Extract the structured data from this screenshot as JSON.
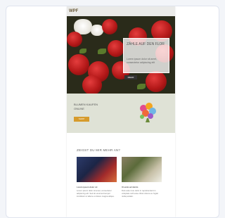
{
  "site": {
    "logo_text": "WPF",
    "hero": {
      "headline": "ZÄHLE AUF DEN FLOR",
      "subtext": "Lorem ipsum dolor sit amet, consectetur adipiscing elit",
      "button_label": "MEHR"
    },
    "band": {
      "headline": "BLUMEN KAUFEN",
      "subline": "ONLINE",
      "button_label": "SHOP"
    },
    "section": {
      "title": "ZEIGST DU MIR MEHR AN?",
      "left_heading": "Lorem ipsum dolor sit",
      "left_text": "Lorem ipsum dolor sit amet, consectetur adipiscing elit. Sed do eiusmod tempor incididunt ut labore et dolore magna aliqua.",
      "right_heading": "Ut enim ad minim",
      "right_text": "Duis aute irure dolor in reprehenderit in voluptate velit esse cillum dolore eu fugiat nulla pariatur."
    }
  }
}
